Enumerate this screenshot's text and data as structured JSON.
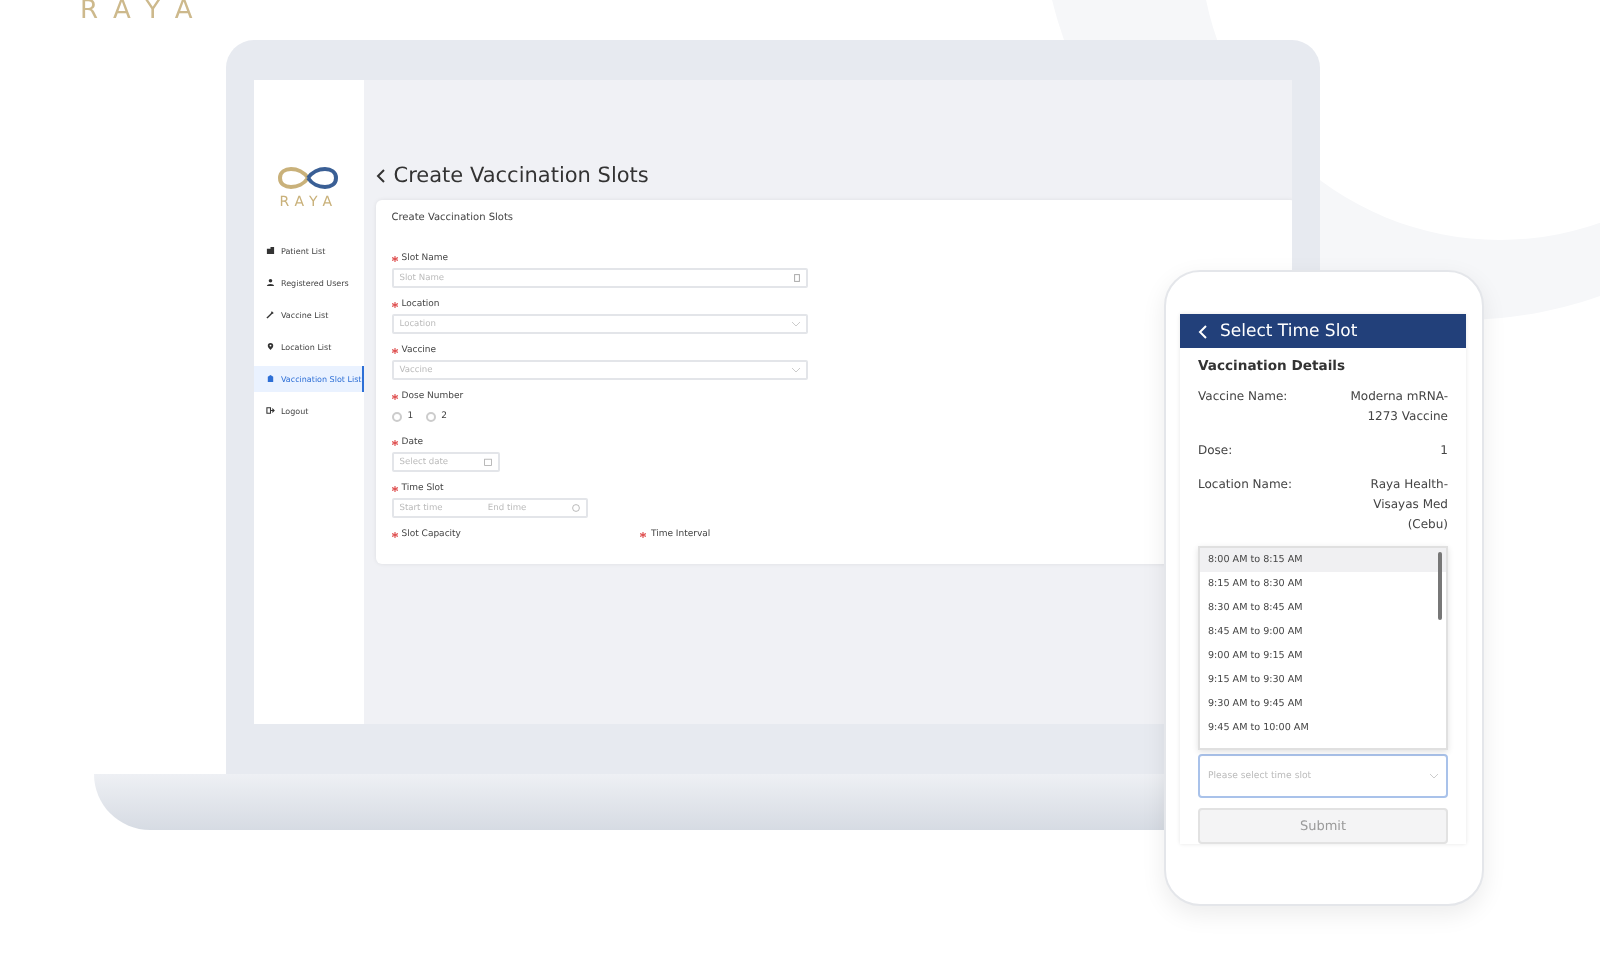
{
  "brand": {
    "wordmark": "RAYA"
  },
  "laptop": {
    "sidebar": {
      "logo_text": "RAYA",
      "items": [
        {
          "label": "Patient List",
          "selected": false
        },
        {
          "label": "Registered Users",
          "selected": false
        },
        {
          "label": "Vaccine List",
          "selected": false
        },
        {
          "label": "Location List",
          "selected": false
        },
        {
          "label": "Vaccination Slot List",
          "selected": true
        },
        {
          "label": "Logout",
          "selected": false
        }
      ]
    },
    "page_title": "Create Vaccination Slots",
    "form": {
      "title": "Create Vaccination Slots",
      "fields": [
        {
          "kind": "text",
          "label": "Slot Name",
          "required": true,
          "placeholder": "Slot Name"
        },
        {
          "kind": "select",
          "label": "Location",
          "required": true,
          "placeholder": "Location"
        },
        {
          "kind": "select",
          "label": "Vaccine",
          "required": true,
          "placeholder": "Vaccine"
        },
        {
          "kind": "radio",
          "label": "Dose Number",
          "required": true,
          "options": [
            {
              "label": "1",
              "selected": false
            },
            {
              "label": "2",
              "selected": false
            }
          ]
        },
        {
          "kind": "date",
          "label": "Date",
          "required": true,
          "placeholder": "Select date"
        },
        {
          "kind": "range",
          "label": "Time Slot",
          "required": true,
          "start_placeholder": "Start time",
          "end_placeholder": "End time"
        }
      ],
      "bottom_labels": [
        {
          "label": "Slot Capacity",
          "required": true
        },
        {
          "label": "Time Interval",
          "required": true
        }
      ]
    }
  },
  "phone": {
    "title": "Select Time Slot",
    "section_title": "Vaccination Details",
    "details": [
      {
        "label": "Vaccine Name:",
        "value": "Moderna mRNA-1273 Vaccine"
      },
      {
        "label": "Dose:",
        "value": "1"
      },
      {
        "label": "Location Name:",
        "value": "Raya Health-Visayas Med (Cebu)"
      }
    ],
    "time_slots": [
      {
        "label": "8:00 AM to 8:15 AM",
        "selected": true
      },
      {
        "label": "8:15 AM to 8:30 AM",
        "selected": false
      },
      {
        "label": "8:30 AM to 8:45 AM",
        "selected": false
      },
      {
        "label": "8:45 AM to 9:00 AM",
        "selected": false
      },
      {
        "label": "9:00 AM to 9:15 AM",
        "selected": false
      },
      {
        "label": "9:15 AM to 9:30 AM",
        "selected": false
      },
      {
        "label": "9:30 AM to 9:45 AM",
        "selected": false
      },
      {
        "label": "9:45 AM to 10:00 AM",
        "selected": false
      }
    ],
    "time_select": {
      "placeholder": "Please select time slot"
    },
    "submit": {
      "label": "Submit",
      "disabled": true
    }
  }
}
